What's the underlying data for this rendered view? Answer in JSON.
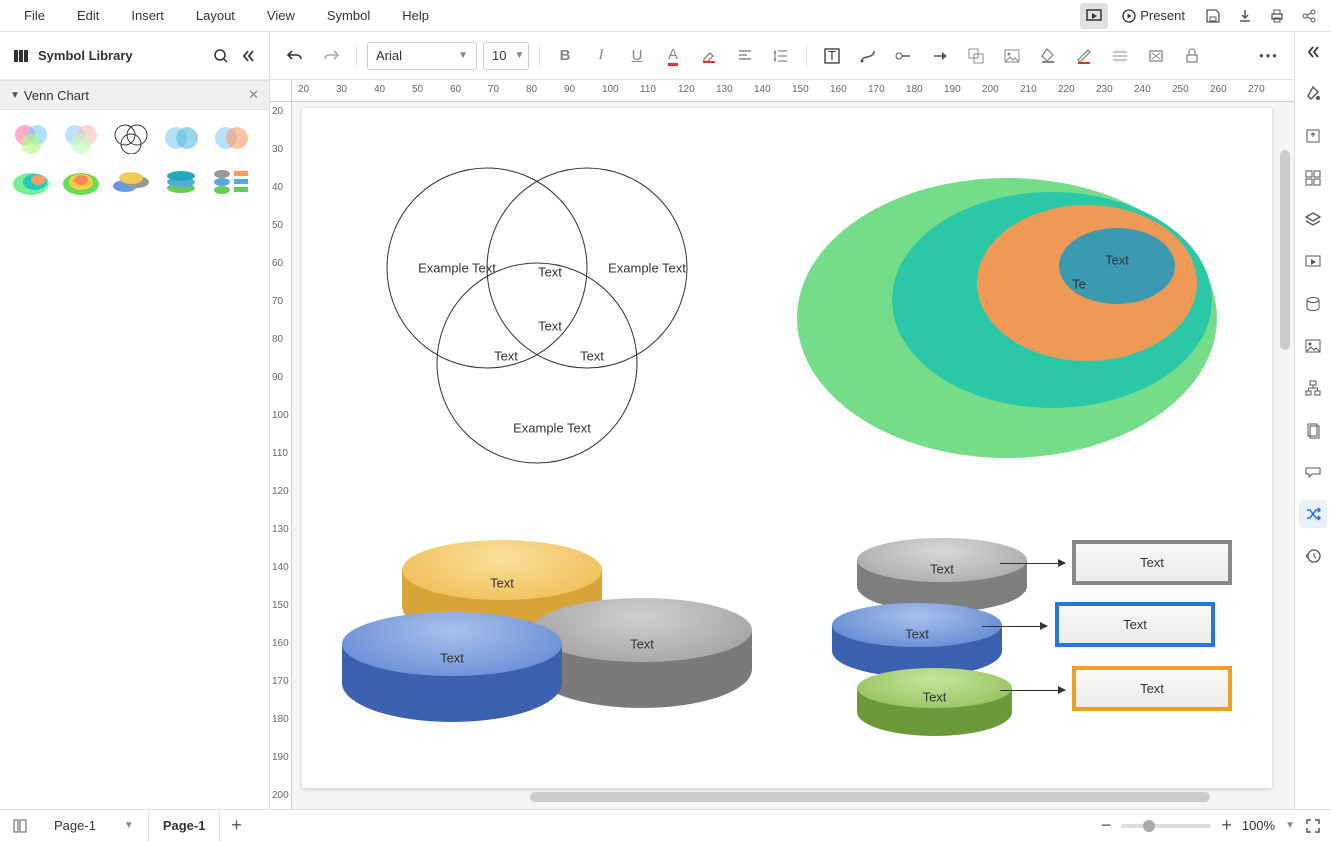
{
  "menu": {
    "file": "File",
    "edit": "Edit",
    "insert": "Insert",
    "layout": "Layout",
    "view": "View",
    "symbol": "Symbol",
    "help": "Help"
  },
  "top": {
    "present": "Present"
  },
  "sidebar": {
    "title": "Symbol Library",
    "section": "Venn Chart"
  },
  "toolbar": {
    "font": "Arial",
    "size": "10"
  },
  "canvas": {
    "venn": {
      "a": "Example Text",
      "b": "Example Text",
      "c": "Example Text",
      "ab": "Text",
      "ac": "Text",
      "bc": "Text",
      "abc": "Text"
    },
    "nested": {
      "inner": "Text",
      "l2": "Te"
    },
    "discs": {
      "yellow": "Text",
      "blue": "Text",
      "gray": "Text"
    },
    "listDiscs": {
      "gray": "Text",
      "blue": "Text",
      "green": "Text"
    },
    "boxes": {
      "gray": "Text",
      "blue": "Text",
      "orange": "Text"
    }
  },
  "ruler_h": [
    "20",
    "30",
    "40",
    "50",
    "60",
    "70",
    "80",
    "90",
    "100",
    "110",
    "120",
    "130",
    "140",
    "150",
    "160",
    "170",
    "180",
    "190",
    "200",
    "210",
    "220",
    "230",
    "240",
    "250",
    "260",
    "270"
  ],
  "ruler_v": [
    "20",
    "30",
    "40",
    "50",
    "60",
    "70",
    "80",
    "90",
    "100",
    "110",
    "120",
    "130",
    "140",
    "150",
    "160",
    "170",
    "180",
    "190",
    "200"
  ],
  "status": {
    "pageSel": "Page-1",
    "pageTab": "Page-1",
    "zoom": "100%"
  }
}
